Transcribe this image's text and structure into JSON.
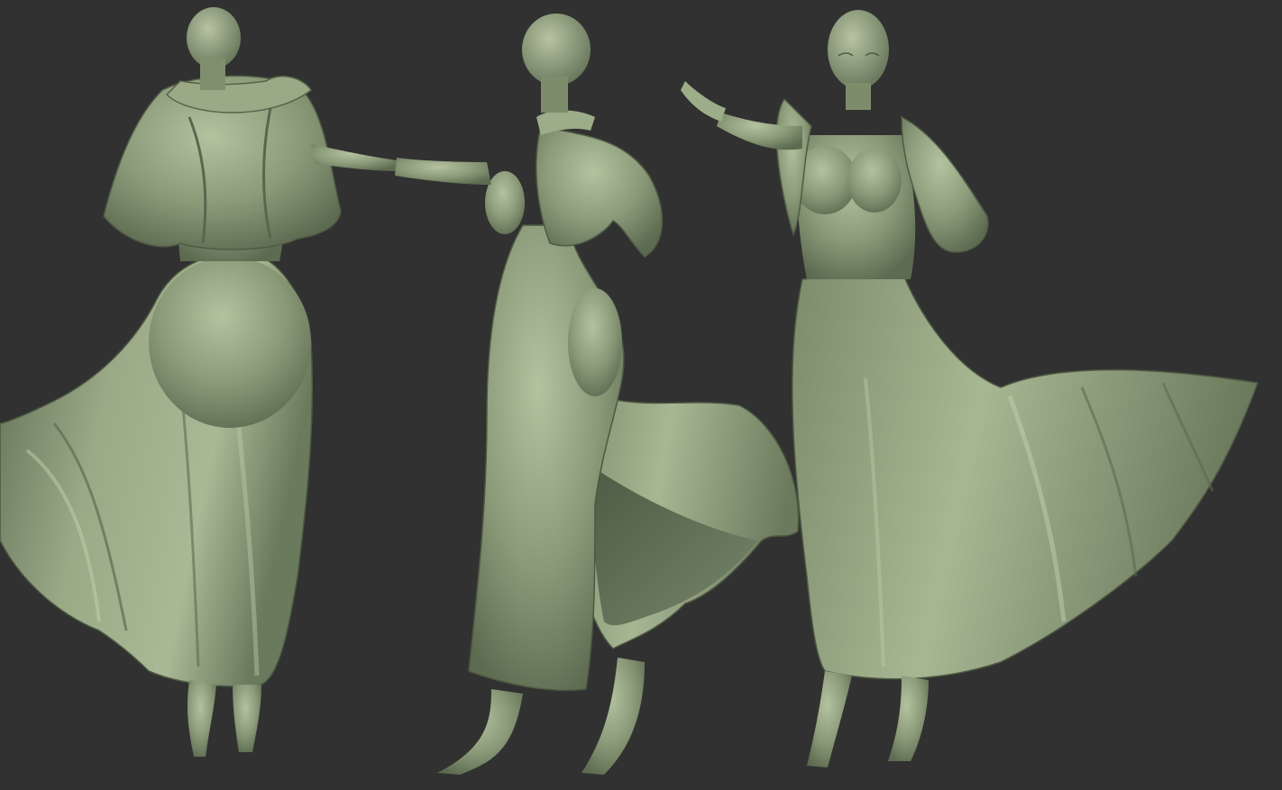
{
  "scene": {
    "background_color": "#313131",
    "clay_color": "#8a9a78",
    "clay_highlight": "#b9c7a5",
    "clay_shadow": "#56644a",
    "figures": [
      {
        "view": "back"
      },
      {
        "view": "side"
      },
      {
        "view": "front"
      }
    ]
  }
}
